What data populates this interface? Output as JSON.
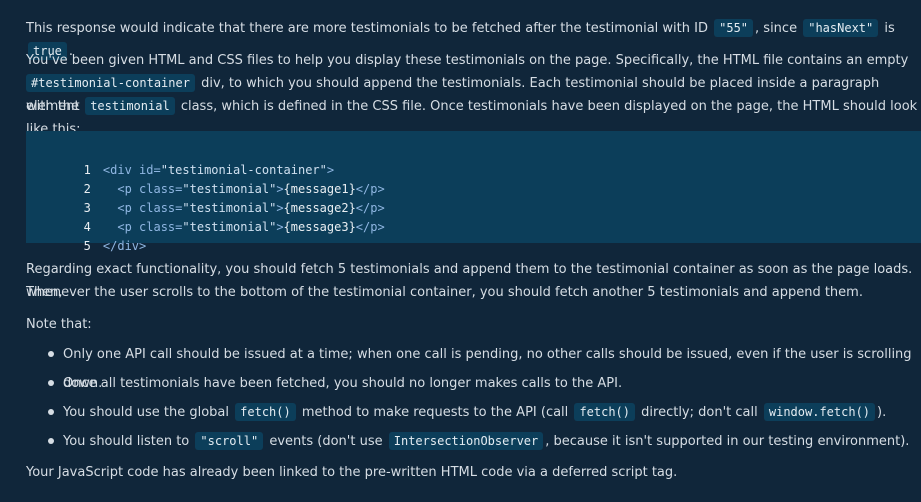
{
  "intro": {
    "p1_a": "This response would indicate that there are more testimonials to be fetched after the testimonial with ID",
    "p1_id": "\"55\"",
    "p1_b": ", since",
    "p1_key": "\"hasNext\"",
    "p1_c": "is",
    "p1_val": "true",
    "p1_d": ".",
    "p2_a": "You've been given HTML and CSS files to help you display these testimonials on the page. Specifically, the HTML file contains an empty",
    "p2_code1": "#testimonial-container",
    "p2_b": "div, to which you should append the testimonials. Each testimonial should be placed inside a paragraph element",
    "p2_c": "with the",
    "p2_code2": "testimonial",
    "p2_d": "class, which is defined in the CSS file. Once testimonials have been displayed on the page, the HTML should look like this:"
  },
  "code": {
    "lines": [
      {
        "num": "1",
        "indent": "",
        "tag_open": "<div",
        "attr": " id=",
        "str": "\"testimonial-container\"",
        "close": ">",
        "text": "",
        "end_tag": ""
      },
      {
        "num": "2",
        "indent": "  ",
        "tag_open": "<p",
        "attr": " class=",
        "str": "\"testimonial\"",
        "close": ">",
        "text": "{message1}",
        "end_tag": "</p>"
      },
      {
        "num": "3",
        "indent": "  ",
        "tag_open": "<p",
        "attr": " class=",
        "str": "\"testimonial\"",
        "close": ">",
        "text": "{message2}",
        "end_tag": "</p>"
      },
      {
        "num": "4",
        "indent": "  ",
        "tag_open": "<p",
        "attr": " class=",
        "str": "\"testimonial\"",
        "close": ">",
        "text": "{message3}",
        "end_tag": "</p>"
      },
      {
        "num": "5",
        "indent": "",
        "tag_open": "</div>",
        "attr": "",
        "str": "",
        "close": "",
        "text": "",
        "end_tag": ""
      }
    ]
  },
  "functionality": {
    "p3_a": "Regarding exact functionality, you should fetch 5 testimonials and append them to the testimonial container as soon as the page loads. Then,",
    "p3_b": "whenever the user scrolls to the bottom of the testimonial container, you should fetch another 5 testimonials and append them.",
    "note_label": "Note that:"
  },
  "notes": {
    "n1": "Only one API call should be issued at a time; when one call is pending, no other calls should be issued, even if the user is scrolling down.",
    "n2": "Once all testimonials have been fetched, you should no longer makes calls to the API.",
    "n3_a": "You should use the global",
    "n3_code1": "fetch()",
    "n3_b": "method to make requests to the API (call",
    "n3_code2": "fetch()",
    "n3_c": "directly; don't call",
    "n3_code3": "window.fetch()",
    "n3_d": ").",
    "n4_a": "You should listen to",
    "n4_code1": "\"scroll\"",
    "n4_b": "events (don't use",
    "n4_code2": "IntersectionObserver",
    "n4_c": ", because it isn't supported in our testing environment)."
  },
  "footer": {
    "p4": "Your JavaScript code has already been linked to the pre-written HTML code via a deferred script tag."
  }
}
